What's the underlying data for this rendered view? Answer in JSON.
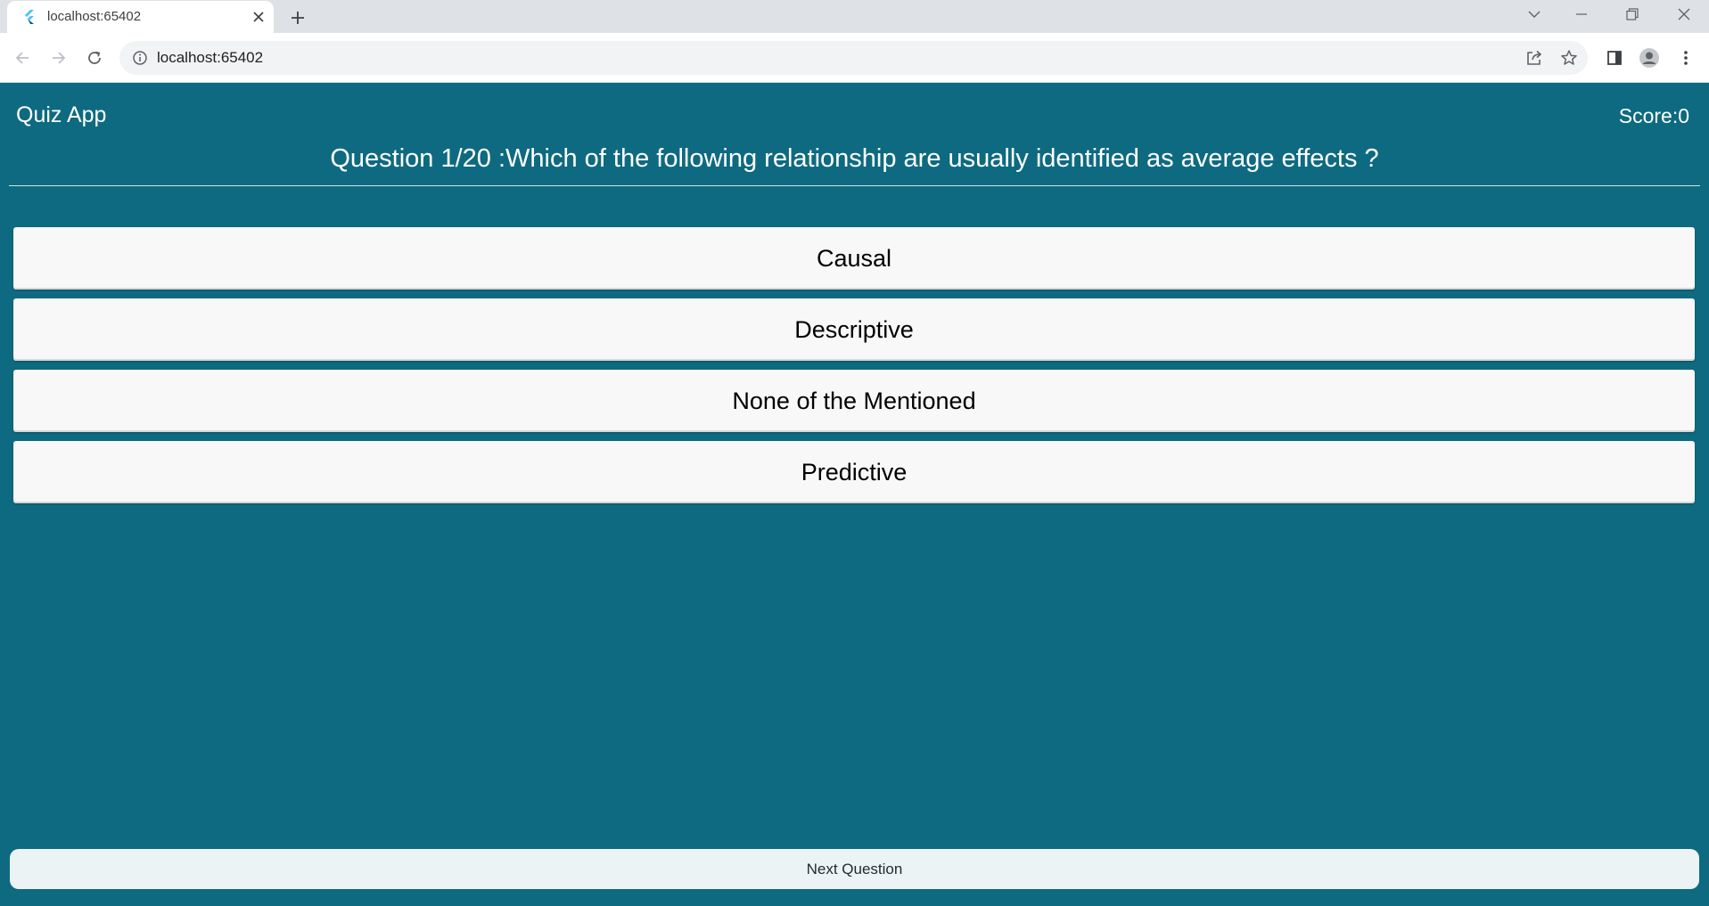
{
  "browser": {
    "tab": {
      "title": "localhost:65402",
      "favicon": "flutter-icon"
    },
    "address_bar": {
      "url": "localhost:65402"
    }
  },
  "app": {
    "title": "Quiz App",
    "score_label": "Score:0",
    "question_text": "Question 1/20 :Which of the following relationship are usually identified as average effects ?",
    "options": [
      {
        "label": "Causal"
      },
      {
        "label": "Descriptive"
      },
      {
        "label": "None of the Mentioned"
      },
      {
        "label": "Predictive"
      }
    ],
    "next_label": "Next Question"
  },
  "colors": {
    "app_background": "#0e6a80",
    "option_background": "#f8f8f8",
    "next_button_background": "#ecf3f4",
    "tabstrip_background": "#dee1e6"
  }
}
